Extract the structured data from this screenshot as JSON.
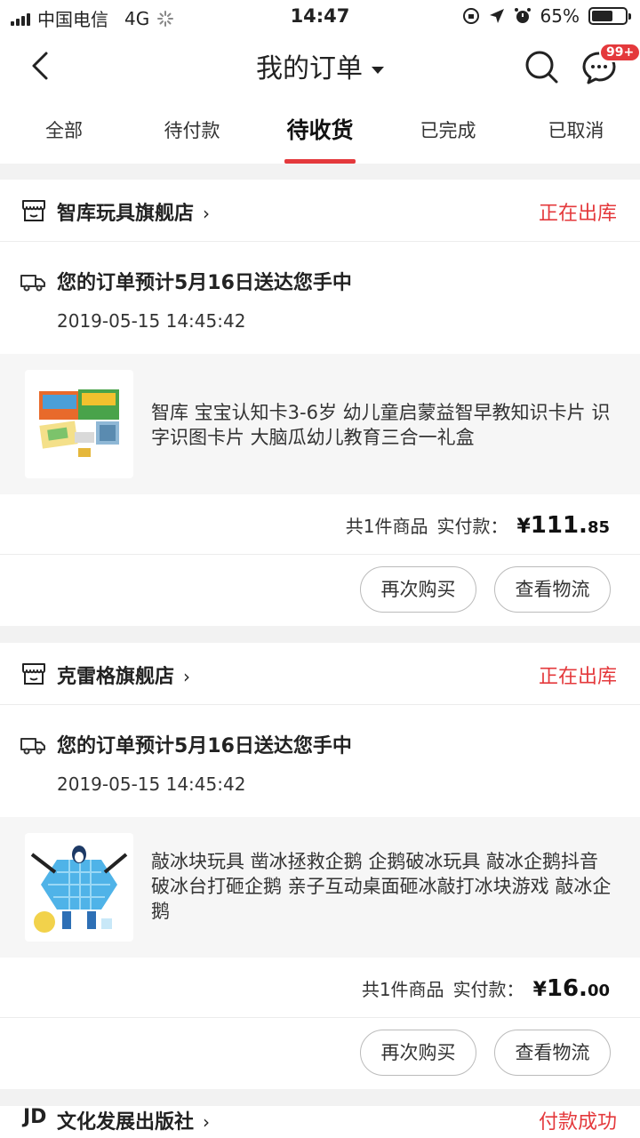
{
  "status_bar": {
    "carrier": "中国电信",
    "network": "4G",
    "time": "14:47",
    "battery": "65%",
    "battery_level": 0.65
  },
  "nav": {
    "title": "我的订单",
    "message_badge": "99+"
  },
  "tabs": [
    {
      "label": "全部"
    },
    {
      "label": "待付款"
    },
    {
      "label": "待收货"
    },
    {
      "label": "已完成"
    },
    {
      "label": "已取消"
    }
  ],
  "orders": [
    {
      "shop": "智库玩具旗舰店",
      "status": "正在出库",
      "delivery": "您的订单预计5月16日送达您手中",
      "time": "2019-05-15 14:45:42",
      "product": "智库 宝宝认知卡3-6岁 幼儿童启蒙益智早教知识卡片 识字识图卡片 大脑瓜幼儿教育三合一礼盒",
      "count_text": "共1件商品",
      "paid_label": "实付款：",
      "price_symbol": "¥",
      "price_int": "111.",
      "price_dec": "85",
      "rebuy": "再次购买",
      "track": "查看物流"
    },
    {
      "shop": "克雷格旗舰店",
      "status": "正在出库",
      "delivery": "您的订单预计5月16日送达您手中",
      "time": "2019-05-15 14:45:42",
      "product": "敲冰块玩具 凿冰拯救企鹅 企鹅破冰玩具 敲冰企鹅抖音破冰台打砸企鹅 亲子互动桌面砸冰敲打冰块游戏 敲冰企鹅",
      "count_text": "共1件商品",
      "paid_label": "实付款：",
      "price_symbol": "¥",
      "price_int": "16.",
      "price_dec": "00",
      "rebuy": "再次购买",
      "track": "查看物流"
    },
    {
      "shop": "文化发展出版社",
      "status": "付款成功"
    }
  ]
}
